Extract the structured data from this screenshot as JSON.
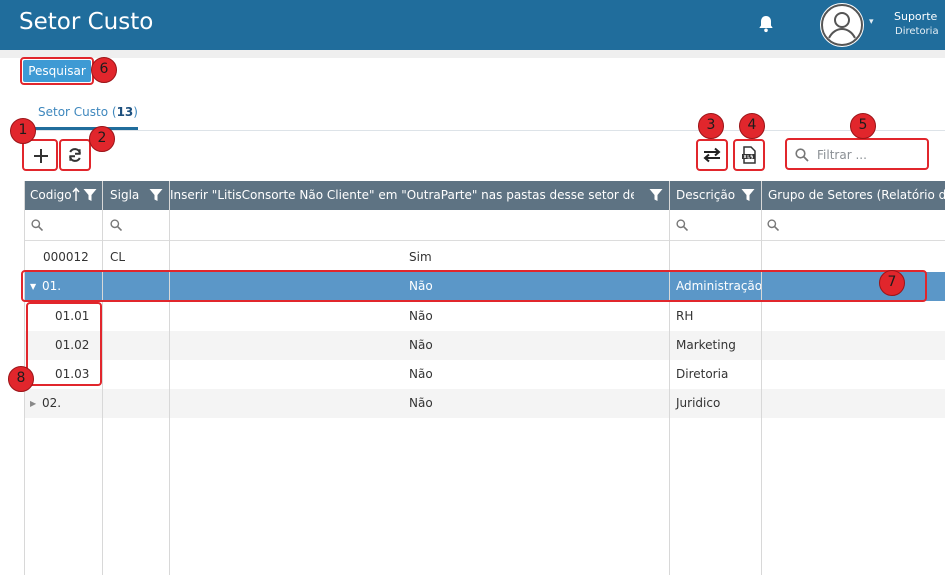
{
  "header": {
    "title": "Setor Custo",
    "user_name": "Suporte",
    "user_role": "Diretoria"
  },
  "actions": {
    "pesquisar_label": "Pesquisar",
    "filter_placeholder": "Filtrar ..."
  },
  "tab": {
    "label": "Setor Custo (",
    "count": "13",
    "suffix": ")"
  },
  "grid": {
    "columns": [
      {
        "label": "Codigo",
        "sort": "asc"
      },
      {
        "label": "Sigla"
      },
      {
        "label": "Inserir \"LitisConsorte Não Cliente\" em \"OutraParte\" nas pastas desse setor de custo"
      },
      {
        "label": "Descrição"
      },
      {
        "label": "Grupo de Setores (Relatório de"
      }
    ],
    "rows": [
      {
        "codigo": "000012",
        "sigla": "CL",
        "inserir": "Sim",
        "descricao": "",
        "grupo": ""
      },
      {
        "codigo": "01.",
        "sigla": "",
        "inserir": "Não",
        "descricao": "Administração",
        "grupo": "",
        "expanded": true
      },
      {
        "codigo": "01.01",
        "sigla": "",
        "inserir": "Não",
        "descricao": "RH",
        "grupo": ""
      },
      {
        "codigo": "01.02",
        "sigla": "",
        "inserir": "Não",
        "descricao": "Marketing",
        "grupo": ""
      },
      {
        "codigo": "01.03",
        "sigla": "",
        "inserir": "Não",
        "descricao": "Diretoria",
        "grupo": ""
      },
      {
        "codigo": "02.",
        "sigla": "",
        "inserir": "Não",
        "descricao": "Juridico",
        "grupo": "",
        "expanded": false
      }
    ]
  },
  "badges": [
    "1",
    "2",
    "3",
    "4",
    "5",
    "6",
    "7",
    "8"
  ],
  "colors": {
    "header_bg": "#206d9c",
    "primary_button": "#3e9ad4",
    "grid_header": "#5e7383",
    "selected_row": "#5b97c8",
    "annotation_red": "#e1262c"
  },
  "icons": [
    "bell-icon",
    "user-avatar-icon",
    "plus-icon",
    "refresh-icon",
    "swap-icon",
    "xlsx-export-icon",
    "search-icon",
    "filter-icon",
    "sort-asc-icon"
  ]
}
